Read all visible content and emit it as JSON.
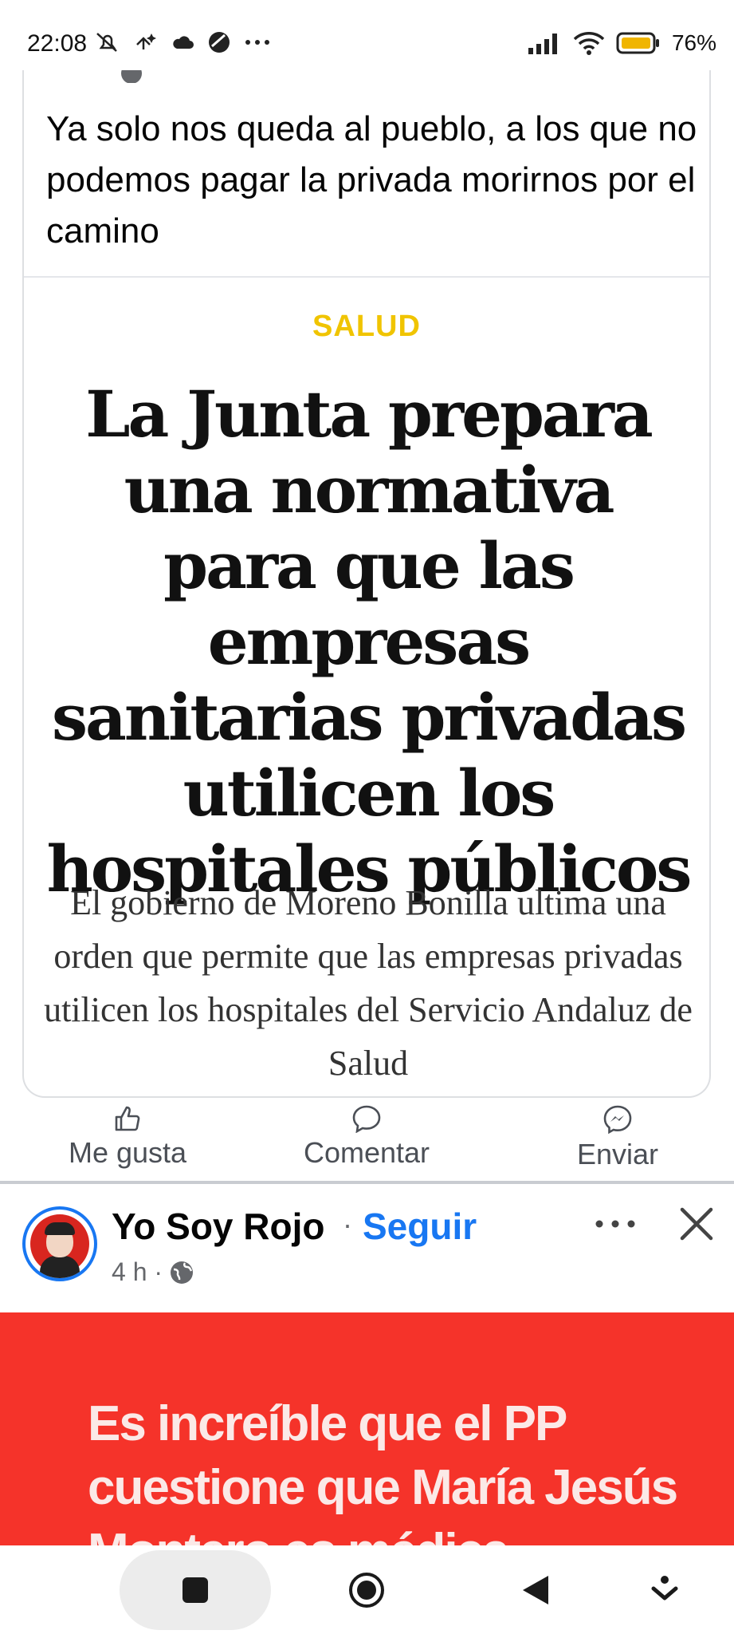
{
  "status_bar": {
    "time": "22:08",
    "battery": "76%"
  },
  "post1": {
    "text": "Ya solo nos queda  al pueblo, a los que no podemos pagar la privada morirnos por el camino",
    "article": {
      "category": "SALUD",
      "headline": "La Junta prepara una normativa para que las empresas sanitarias privadas utilicen los hospitales públicos",
      "subheadline": "El gobierno de Moreno Bonilla ultima una orden que permite que las empresas privadas utilicen los hospitales del Servicio Andaluz de Salud"
    }
  },
  "actions": {
    "like": "Me gusta",
    "comment": "Comentar",
    "send": "Enviar"
  },
  "post2": {
    "page_name": "Yo Soy Rojo",
    "separator": "·",
    "follow": "Seguir",
    "time": "4 h ·",
    "image_text": "Es increíble que el PP cuestione que María Jesús Montero es médica"
  },
  "colors": {
    "accent_blue": "#1877f2",
    "category_yellow": "#f0c400",
    "banner_red": "#f5332a"
  },
  "icons": [
    "mute-icon",
    "assistant-icon",
    "cloud-icon",
    "app-icon",
    "more-dots-icon",
    "signal-icon",
    "wifi-icon",
    "battery-icon",
    "globe-icon",
    "like-icon",
    "comment-icon",
    "messenger-icon",
    "close-icon",
    "recents-icon",
    "home-icon",
    "back-icon",
    "hide-nav-icon"
  ]
}
